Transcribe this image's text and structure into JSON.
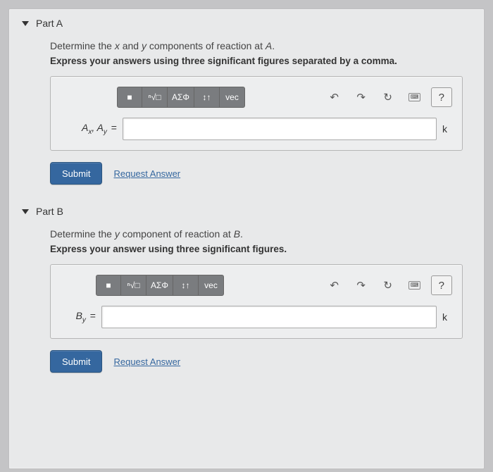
{
  "parts": [
    {
      "title": "Part A",
      "prompt_html": "Determine the <i>x</i> and <i>y</i> components of reaction at <i>A</i>.",
      "instruction": "Express your answers using three significant figures separated by a comma.",
      "var_label_html": "A<sub>x</sub>, A<sub>y</sub>",
      "unit": "k",
      "submit": "Submit",
      "request": "Request Answer"
    },
    {
      "title": "Part B",
      "prompt_html": "Determine the <i>y</i> component of reaction at <i>B</i>.",
      "instruction": "Express your answer using three significant figures.",
      "var_label_html": "B<sub>y</sub>",
      "unit": "k",
      "submit": "Submit",
      "request": "Request Answer"
    }
  ],
  "toolbar": {
    "templates": "■",
    "root": "ⁿ√□",
    "greek": "ΑΣΦ",
    "scripts": "↕↑",
    "vec": "vec",
    "undo": "↶",
    "redo": "↷",
    "reset": "↻",
    "keyboard": "⌨",
    "help": "?"
  }
}
